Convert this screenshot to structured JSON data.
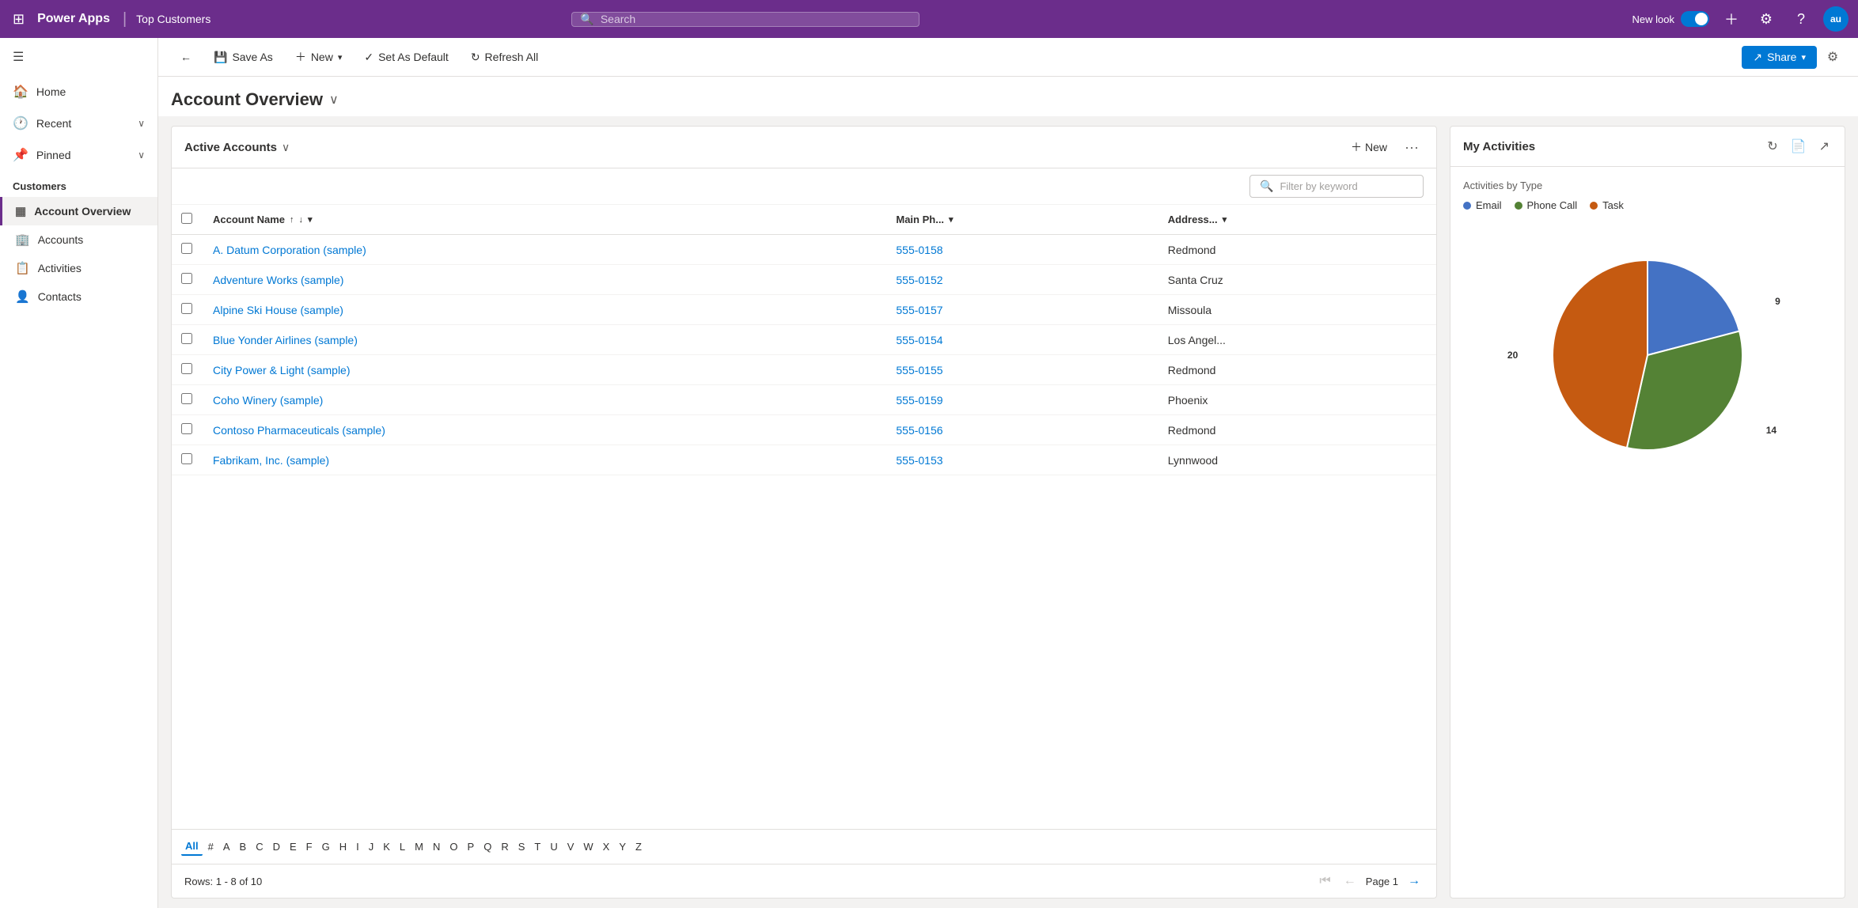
{
  "topNav": {
    "brand": "Power Apps",
    "appName": "Top Customers",
    "searchPlaceholder": "Search",
    "newLookLabel": "New look",
    "avatarInitials": "au"
  },
  "toolbar": {
    "backLabel": "←",
    "saveAsLabel": "Save As",
    "newLabel": "New",
    "setAsDefaultLabel": "Set As Default",
    "refreshAllLabel": "Refresh All",
    "shareLabel": "Share"
  },
  "pageHeader": {
    "title": "Account Overview"
  },
  "accountsPanel": {
    "title": "Active Accounts",
    "newLabel": "New",
    "filterPlaceholder": "Filter by keyword",
    "columns": {
      "accountName": "Account Name",
      "mainPhone": "Main Ph...",
      "address": "Address..."
    },
    "rows": [
      {
        "name": "A. Datum Corporation (sample)",
        "phone": "555-0158",
        "address": "Redmond"
      },
      {
        "name": "Adventure Works (sample)",
        "phone": "555-0152",
        "address": "Santa Cruz"
      },
      {
        "name": "Alpine Ski House (sample)",
        "phone": "555-0157",
        "address": "Missoula"
      },
      {
        "name": "Blue Yonder Airlines (sample)",
        "phone": "555-0154",
        "address": "Los Angel..."
      },
      {
        "name": "City Power & Light (sample)",
        "phone": "555-0155",
        "address": "Redmond"
      },
      {
        "name": "Coho Winery (sample)",
        "phone": "555-0159",
        "address": "Phoenix"
      },
      {
        "name": "Contoso Pharmaceuticals (sample)",
        "phone": "555-0156",
        "address": "Redmond"
      },
      {
        "name": "Fabrikam, Inc. (sample)",
        "phone": "555-0153",
        "address": "Lynnwood"
      }
    ],
    "alphabet": [
      "All",
      "#",
      "A",
      "B",
      "C",
      "D",
      "E",
      "F",
      "G",
      "H",
      "I",
      "J",
      "K",
      "L",
      "M",
      "N",
      "O",
      "P",
      "Q",
      "R",
      "S",
      "T",
      "U",
      "V",
      "W",
      "X",
      "Y",
      "Z"
    ],
    "rowsInfo": "Rows: 1 - 8 of 10",
    "pageLabel": "Page 1"
  },
  "activitiesPanel": {
    "title": "My Activities",
    "byTypeLabel": "Activities by Type",
    "legend": [
      {
        "label": "Email",
        "color": "#4472c4"
      },
      {
        "label": "Phone Call",
        "color": "#548235"
      },
      {
        "label": "Task",
        "color": "#c55a11"
      }
    ],
    "chartData": [
      {
        "label": "Email",
        "value": 9,
        "color": "#4472c4"
      },
      {
        "label": "Phone Call",
        "value": 14,
        "color": "#548235"
      },
      {
        "label": "Task",
        "value": 20,
        "color": "#c55a11"
      }
    ]
  },
  "sidebar": {
    "navItems": [
      {
        "label": "Home",
        "icon": "🏠"
      },
      {
        "label": "Recent",
        "icon": "🕐",
        "hasChevron": true
      },
      {
        "label": "Pinned",
        "icon": "📌",
        "hasChevron": true
      }
    ],
    "sectionTitle": "Customers",
    "subItems": [
      {
        "label": "Account Overview",
        "icon": "▦",
        "active": true
      },
      {
        "label": "Accounts",
        "icon": "🏢"
      },
      {
        "label": "Activities",
        "icon": "📋"
      },
      {
        "label": "Contacts",
        "icon": "👤"
      }
    ]
  }
}
